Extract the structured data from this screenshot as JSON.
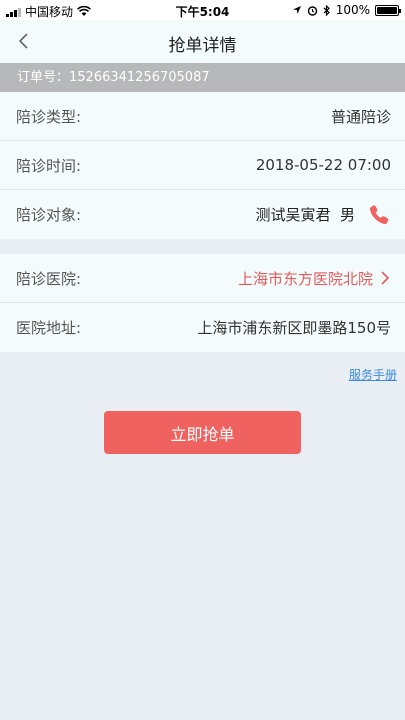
{
  "status": {
    "carrier": "中国移动",
    "time": "下午5:04",
    "battery": "100%",
    "battery_level": 1.0
  },
  "nav": {
    "title": "抢单详情"
  },
  "order": {
    "text": "订单号：15266341256705087"
  },
  "details": [
    {
      "label": "陪诊类型:",
      "value": "普通陪诊"
    },
    {
      "label": "陪诊时间:",
      "value": "2018-05-22 07:00"
    },
    {
      "label": "陪诊对象:",
      "value": "测试吴寅君  男"
    }
  ],
  "hospital": [
    {
      "label": "陪诊医院:",
      "value": "上海市东方医院北院"
    },
    {
      "label": "医院地址:",
      "value": "上海市浦东新区即墨路150号"
    }
  ],
  "links": {
    "manual": "服务手册"
  },
  "actions": {
    "grab": "立即抢单"
  },
  "colors": {
    "accent": "#f0625f",
    "link": "#3b8be0",
    "hospital_text": "#e55a5a"
  },
  "icons": [
    "wifi-icon",
    "location-icon",
    "alarm-icon",
    "bluetooth-icon",
    "back-icon",
    "phone-icon",
    "chevron-right-icon"
  ]
}
